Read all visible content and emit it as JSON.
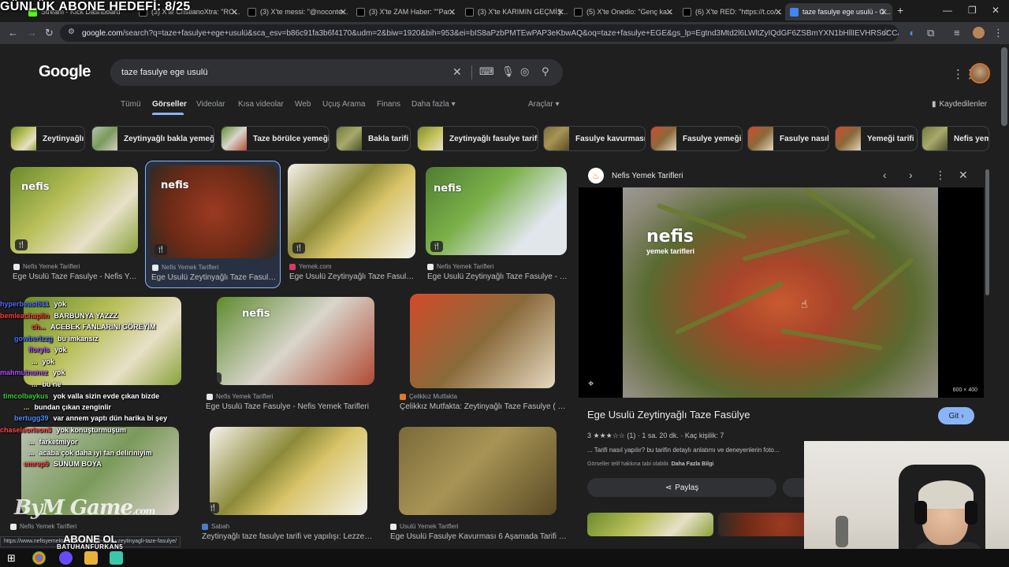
{
  "stream_overlay": {
    "title": "GÜNLÜK ABONE HEDEFİ: 8/25",
    "brand_watermark": "ByM Game",
    "brand_watermark_suffix": ".com",
    "subscribe_text": "ABONE OL",
    "channel_name": "BATUHANFURKAN5"
  },
  "browser": {
    "tabs": [
      {
        "label": "Stream - Kick Dashboard",
        "favicon": "kick-icon",
        "active": false
      },
      {
        "label": "(3) X'te CristianoXtra: \"RO...",
        "favicon": "x-icon",
        "active": false
      },
      {
        "label": "(3) X'te messi: \"@noconte...",
        "favicon": "x-icon",
        "active": false
      },
      {
        "label": "(3) X'te ZAM Haber: \"\"Par...",
        "favicon": "x-icon",
        "active": false
      },
      {
        "label": "(3) X'te KARIMIN GEÇMİŞ...",
        "favicon": "x-icon",
        "active": false
      },
      {
        "label": "(5) X'te Onedio: \"Genç ka...",
        "favicon": "x-icon",
        "active": false
      },
      {
        "label": "(6) X'te RED: \"https://t.co/...",
        "favicon": "x-icon",
        "active": false
      },
      {
        "label": "taze fasulye ege usulü - G...",
        "favicon": "google-icon",
        "active": true
      }
    ],
    "new_tab": "+",
    "address_host": "google.com",
    "address_path": "/search?q=taze+fasulye+ege+usulü&sca_esv=b86c91fa3b6f4170&udm=2&biw=1920&bih=953&ei=bIS8aPzbPMTEwPAP3eKbwAQ&oq=taze+fasulye+EGE&gs_lp=Egtnd3Mtd2l6LWltZyIQdGF6ZSBmYXN1bHllIEVHRSoCCAAyBRAAG...",
    "status_url": "https://www.nefisyemektarifleri.com/ege-usulu-zeytinyagli-taze-fasulye/"
  },
  "google": {
    "logo": "Google",
    "query": "taze fasulye ege usulü",
    "search_tabs": [
      "Tümü",
      "Görseller",
      "Videolar",
      "Kısa videolar",
      "Web",
      "Uçuş Arama",
      "Finans",
      "Daha fazla ▾"
    ],
    "active_tab": "Görseller",
    "tools_label": "Araçlar ▾",
    "saved_label": "Kaydedilenler",
    "chips": [
      "Zeytinyağlı",
      "Zeytinyağlı bakla yemeği",
      "Taze börülce yemeği",
      "Bakla tarifi",
      "Zeytinyağlı fasulye tarifi",
      "Fasulye kavurması",
      "Fasulye yemeği",
      "Fasulye nasıl",
      "Yemeği tarifi",
      "Nefis yeme"
    ],
    "results": [
      {
        "source": "Nefis Yemek Tarifleri",
        "title": "Ege Usulü Taze Fasulye - Nefis Ye..."
      },
      {
        "source": "Nefis Yemek Tarifleri",
        "title": "Ege Usulü Zeytinyağlı Taze Fasuly..."
      },
      {
        "source": "Yemek.com",
        "title": "Ege Usulü Zeytinyağlı Taze Fasuly..."
      },
      {
        "source": "Nefis Yemek Tarifleri",
        "title": "Ege Usulü Zeytinyağlı Taze Fasulye - Nefis Yeme..."
      },
      {
        "source": "Nefis Yemek Tarifleri",
        "title": "Ege Usulü Taze Fasulye - Nefis Yemek Tarifleri"
      },
      {
        "source": "Çelikkız Mutfakta",
        "title": "Çelikkız Mutfakta: Zeytinyağlı Taze Fasulye ( E..."
      },
      {
        "source": "Nefis Yemek Tarifleri",
        "title": "Ege Usulü Zeytinyağlı..."
      },
      {
        "source": "Sabah",
        "title": "Zeytinyağlı taze fasulye tarifi ve yapılışı: Lezzetli ..."
      },
      {
        "source": "Usulü Yemek Tarifleri",
        "title": "Ege Usulü Fasulye Kavurması 6 Aşamada Tarifi | ..."
      }
    ],
    "watermark": "nefis",
    "watermark_sub": "yemek tarifleri"
  },
  "panel": {
    "source": "Nefis Yemek Tarifleri",
    "title": "Ege Usulü Zeytinyağlı Taze Fasülye",
    "visit_label": "Git",
    "rating": "3",
    "stars": "★★★☆☆",
    "rating_count": "(1)",
    "time": "1 sa. 20 dk.",
    "servings": "Kaç kişilik: 7",
    "description": "... Tarifi nasıl yapılır? bu tarifin detaylı anlatımı ve deneyenlerin foto...",
    "copyright": "Görseller telif hakkına tabi olabilir.",
    "learn_more": "Daha Fazla Bilgi",
    "share_label": "Paylaş",
    "dimensions": "600 × 400"
  },
  "chat": [
    {
      "user": "hyperbeast611",
      "message": "yok",
      "color": "#4a6cff"
    },
    {
      "user": "bemleachaplin",
      "message": "BARBUNYA YAZZZ",
      "color": "#ff3a3a"
    },
    {
      "user": "ch...",
      "message": "ACEBEK FANLARINI GÖREYİM",
      "color": "#ff3a3a"
    },
    {
      "user": "gowberlzzg",
      "message": "bu imkansız",
      "color": "#4a6cff"
    },
    {
      "user": "floryis",
      "message": "yok",
      "color": "#b04aff"
    },
    {
      "user": "...",
      "message": "yok",
      "color": "#ffffff"
    },
    {
      "user": "mahmutnunez",
      "message": "yok",
      "color": "#b04aff"
    },
    {
      "user": "...",
      "message": "bu ne",
      "color": "#ffffff"
    },
    {
      "user": "timcolbaykus",
      "message": "yok valla sizin evde çıkan bizde",
      "color": "#3acc3a"
    },
    {
      "user": "...",
      "message": "bundan çıkan zenginlir",
      "color": "#ffcc33"
    },
    {
      "user": "bertugg39",
      "message": "var annem yaptı dün harika bi şey",
      "color": "#4a8cff"
    },
    {
      "user": "chaseleorleon3",
      "message": "yok konuşturmuşum",
      "color": "#ff4a4a"
    },
    {
      "user": "...",
      "message": "farketmiyor",
      "color": "#ffffff"
    },
    {
      "user": "...",
      "message": "acaba çok daha iyi fan deliriniyim",
      "color": "#ffffff"
    },
    {
      "user": "emrep9",
      "message": "SUNUM BOYA",
      "color": "#ff4a4a"
    }
  ]
}
